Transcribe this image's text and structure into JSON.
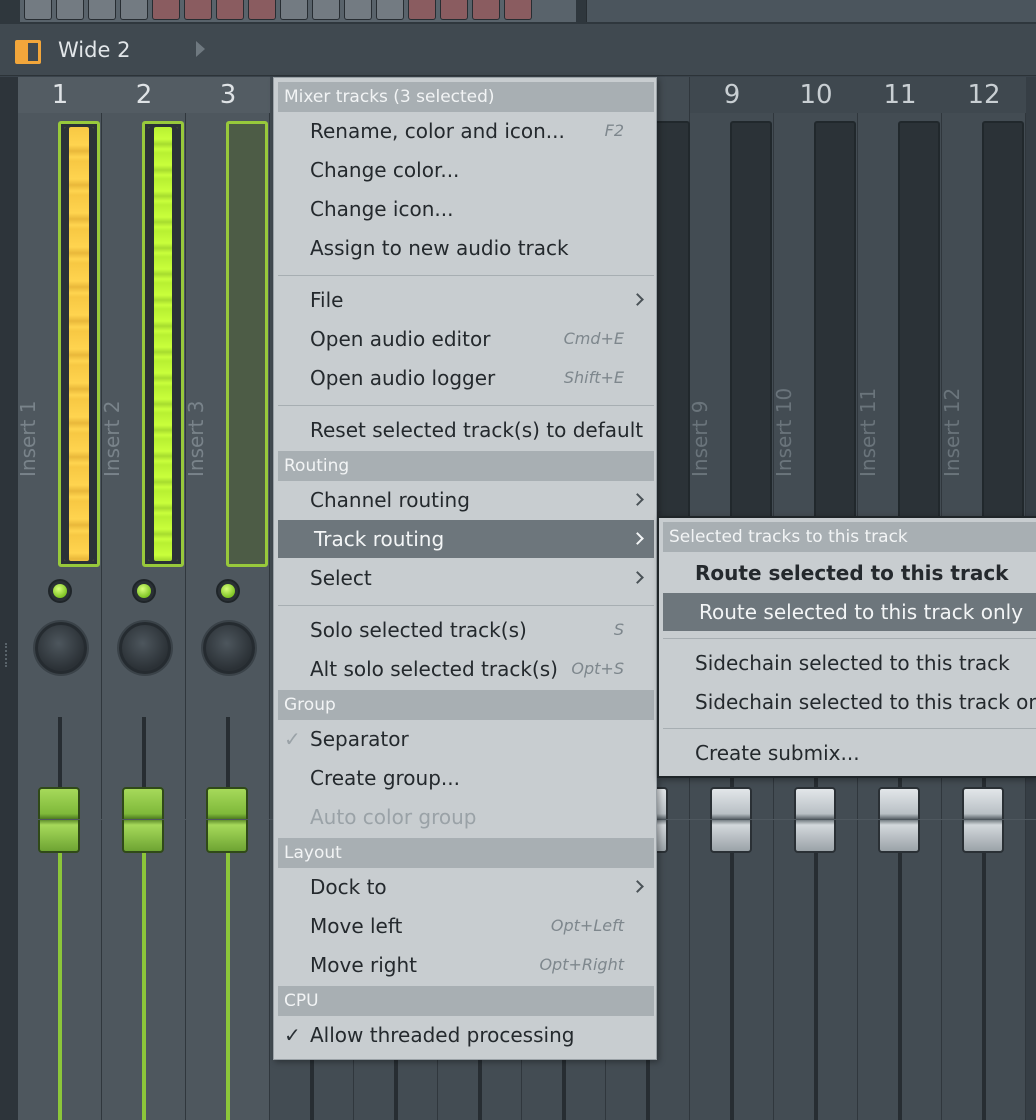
{
  "top_strip": {
    "buttons": [
      "grey",
      "grey",
      "grey",
      "grey",
      "red",
      "red",
      "red",
      "red",
      "grey",
      "grey",
      "grey",
      "grey",
      "red",
      "red",
      "red",
      "red"
    ]
  },
  "title_bar": {
    "title": "Wide 2",
    "icon": "mixer-layout-icon"
  },
  "mixer": {
    "strips": [
      {
        "number": "1",
        "label": "Insert 1",
        "selected": true,
        "meter": "yellow"
      },
      {
        "number": "2",
        "label": "Insert 2",
        "selected": true,
        "meter": "lime"
      },
      {
        "number": "3",
        "label": "Insert 3",
        "selected": true,
        "meter": "empty",
        "active": true
      },
      {
        "number": "9",
        "label": "Insert 9",
        "selected": false
      },
      {
        "number": "10",
        "label": "Insert 10",
        "selected": false
      },
      {
        "number": "11",
        "label": "Insert 11",
        "selected": false
      },
      {
        "number": "12",
        "label": "Insert 12",
        "selected": false
      }
    ]
  },
  "context_menu": {
    "header": "Mixer tracks (3 selected)",
    "items": {
      "rename": {
        "label": "Rename, color and icon...",
        "shortcut": "F2"
      },
      "change_color": {
        "label": "Change color..."
      },
      "change_icon": {
        "label": "Change icon..."
      },
      "assign_audio": {
        "label": "Assign to new audio track"
      },
      "file": {
        "label": "File"
      },
      "open_editor": {
        "label": "Open audio editor",
        "shortcut": "Cmd+E"
      },
      "open_logger": {
        "label": "Open audio logger",
        "shortcut": "Shift+E"
      },
      "reset": {
        "label": "Reset selected track(s) to default"
      },
      "channel_routing": {
        "label": "Channel routing"
      },
      "track_routing": {
        "label": "Track routing"
      },
      "select": {
        "label": "Select"
      },
      "solo": {
        "label": "Solo selected track(s)",
        "shortcut": "S"
      },
      "alt_solo": {
        "label": "Alt solo selected track(s)",
        "shortcut": "Opt+S"
      },
      "separator": {
        "label": "Separator",
        "check": "✓"
      },
      "create_group": {
        "label": "Create group..."
      },
      "auto_color": {
        "label": "Auto color group"
      },
      "dock_to": {
        "label": "Dock to"
      },
      "move_left": {
        "label": "Move left",
        "shortcut": "Opt+Left"
      },
      "move_right": {
        "label": "Move right",
        "shortcut": "Opt+Right"
      },
      "threaded": {
        "label": "Allow threaded processing",
        "check": "✓"
      }
    },
    "sections": {
      "routing": "Routing",
      "group": "Group",
      "layout": "Layout",
      "cpu": "CPU"
    }
  },
  "submenu": {
    "header": "Selected tracks to this track",
    "items": {
      "route": "Route selected to this track",
      "route_only": "Route selected to this track only",
      "sidechain": "Sidechain selected to this track",
      "sidechain_only": "Sidechain selected to this track only",
      "submix": "Create submix..."
    }
  },
  "colors": {
    "accent_orange": "#f2a63b",
    "meter_yellow": "#ffd44f",
    "meter_lime": "#c9ff3b",
    "menu_bg": "#c8cdd0",
    "menu_highlight": "#6d767c"
  }
}
